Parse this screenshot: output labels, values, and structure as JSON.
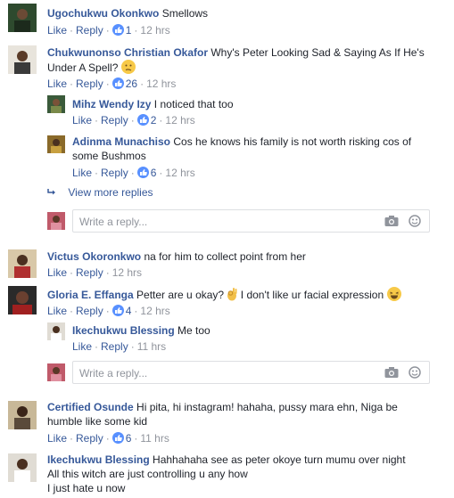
{
  "ui": {
    "like_label": "Like",
    "reply_label": "Reply",
    "reply_placeholder": "Write a reply...",
    "view_more_label": "View more replies",
    "colors": {
      "name": "#365899",
      "muted": "#90949c",
      "like_badge": "#5890ff",
      "text": "#1d2129"
    }
  },
  "comments": [
    {
      "name": "Ugochukwu Okonkwo",
      "text": "Smellows",
      "likes": "1",
      "time": "12 hrs"
    },
    {
      "name": "Chukwunonso Christian Okafor",
      "text_line1": "Why's Peter Looking Sad & Saying As If He's",
      "text_line2": "Under A Spell?",
      "emoji": "confused-face-emoji",
      "likes": "26",
      "time": "12 hrs",
      "replies": [
        {
          "name": "Mihz Wendy Izy",
          "text": "I noticed that too",
          "likes": "2",
          "time": "12 hrs"
        },
        {
          "name": "Adinma Munachiso",
          "text_line1": "Cos he knows his family is not worth risking cos of",
          "text_line2": "some Bushmos",
          "likes": "6",
          "time": "12 hrs"
        }
      ]
    },
    {
      "name": "Victus Okoronkwo",
      "text": "na for him to collect point from her",
      "time": "12 hrs"
    },
    {
      "name": "Gloria E. Effanga",
      "text_a": "Petter are u okay?",
      "text_b": "I don't like ur facial expression",
      "likes": "4",
      "time": "12 hrs",
      "replies": [
        {
          "name": "Ikechukwu Blessing",
          "text": "Me too",
          "time": "11 hrs"
        }
      ]
    },
    {
      "name": "Certified Osunde",
      "text_line1": "Hi pita, hi instagram! hahaha, pussy mara ehn, Niga be",
      "text_line2": "humble like some kid",
      "likes": "6",
      "time": "11 hrs"
    },
    {
      "name": "Ikechukwu Blessing",
      "text_line1": "Hahhahaha see as peter okoye turn mumu over night",
      "text_line2": "All this witch are just controlling u any how",
      "text_line3": "I just hate u now"
    }
  ]
}
